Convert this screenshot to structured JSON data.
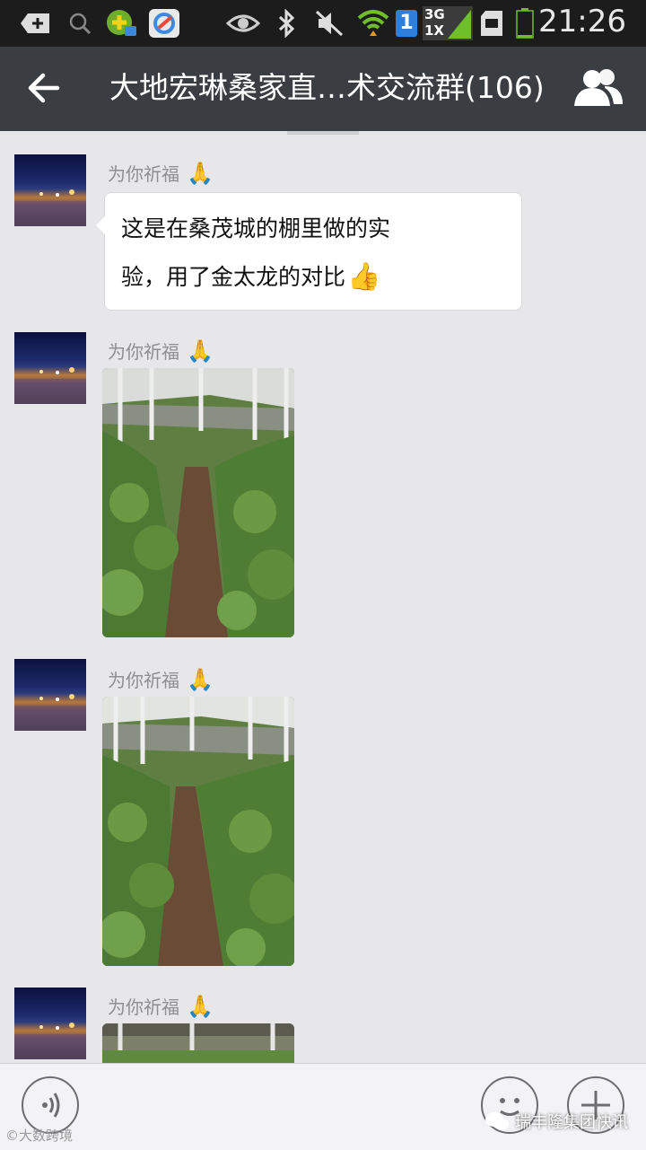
{
  "status_bar": {
    "time": "21:26",
    "network_type_top": "3G",
    "network_type_bottom": "1X",
    "sim_slot": "1",
    "icons": [
      "usb-debug-icon",
      "search-icon",
      "app-notification-icon",
      "app-notification-icon-2",
      "eye-icon",
      "bluetooth-icon",
      "mute-icon",
      "wifi-icon",
      "sim-icon",
      "signal-icon",
      "sd-card-icon",
      "battery-icon"
    ]
  },
  "header": {
    "title": "大地宏琳桑家直…术交流群(106)",
    "back_icon": "arrow-left-icon",
    "members_icon": "group-members-icon"
  },
  "messages": [
    {
      "type": "text",
      "sender": "为你祈福",
      "sender_emoji": "🙏",
      "line1": "这是在桑茂城的棚里做的实",
      "line2": "验，用了金太龙的对比",
      "line2_emoji": "👍"
    },
    {
      "type": "image",
      "sender": "为你祈福",
      "sender_emoji": "🙏",
      "alt": "greenhouse-tomato-photo"
    },
    {
      "type": "image",
      "sender": "为你祈福",
      "sender_emoji": "🙏",
      "alt": "greenhouse-tomato-photo"
    },
    {
      "type": "image",
      "sender": "为你祈福",
      "sender_emoji": "🙏",
      "alt": "greenhouse-tomato-photo"
    }
  ],
  "input_bar": {
    "voice_icon": "voice-input-icon",
    "emoji_icon": "emoji-face-icon",
    "plus_icon": "plus-icon"
  },
  "watermarks": {
    "left": "©大数跨境",
    "right": "瑞丰隆集团快讯"
  },
  "colors": {
    "status_bar": "#1c1c1c",
    "title_bar": "#3a3d42",
    "chat_background": "#e7e7e9",
    "bubble": "#ffffff"
  }
}
